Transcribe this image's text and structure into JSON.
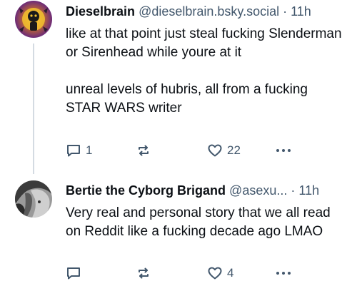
{
  "posts": [
    {
      "author_name": "Dieselbrain",
      "handle": "@dieselbrain.bsky.social",
      "separator": "·",
      "time": "11h",
      "text": "like at that point just steal fucking Slenderman or Sirenhead while youre at it\n\nunreal levels of hubris, all from a fucking STAR WARS writer",
      "reply_count": "1",
      "repost_count": "",
      "like_count": "22"
    },
    {
      "author_name": "Bertie the Cyborg Brigand",
      "handle": "@asexu...",
      "separator": "·",
      "time": "11h",
      "text": "Very real and personal story that we all read on Reddit like a fucking decade ago LMAO",
      "reply_count": "",
      "repost_count": "",
      "like_count": "4"
    }
  ],
  "colors": {
    "text": "#0b0f14",
    "secondary": "#42576c",
    "thread_line": "#d4dbe2",
    "avatar1_bg": "#7a2f84",
    "avatar1_glow": "#f2c230"
  },
  "icons": [
    "reply-icon",
    "repost-icon",
    "like-icon",
    "more-icon"
  ]
}
